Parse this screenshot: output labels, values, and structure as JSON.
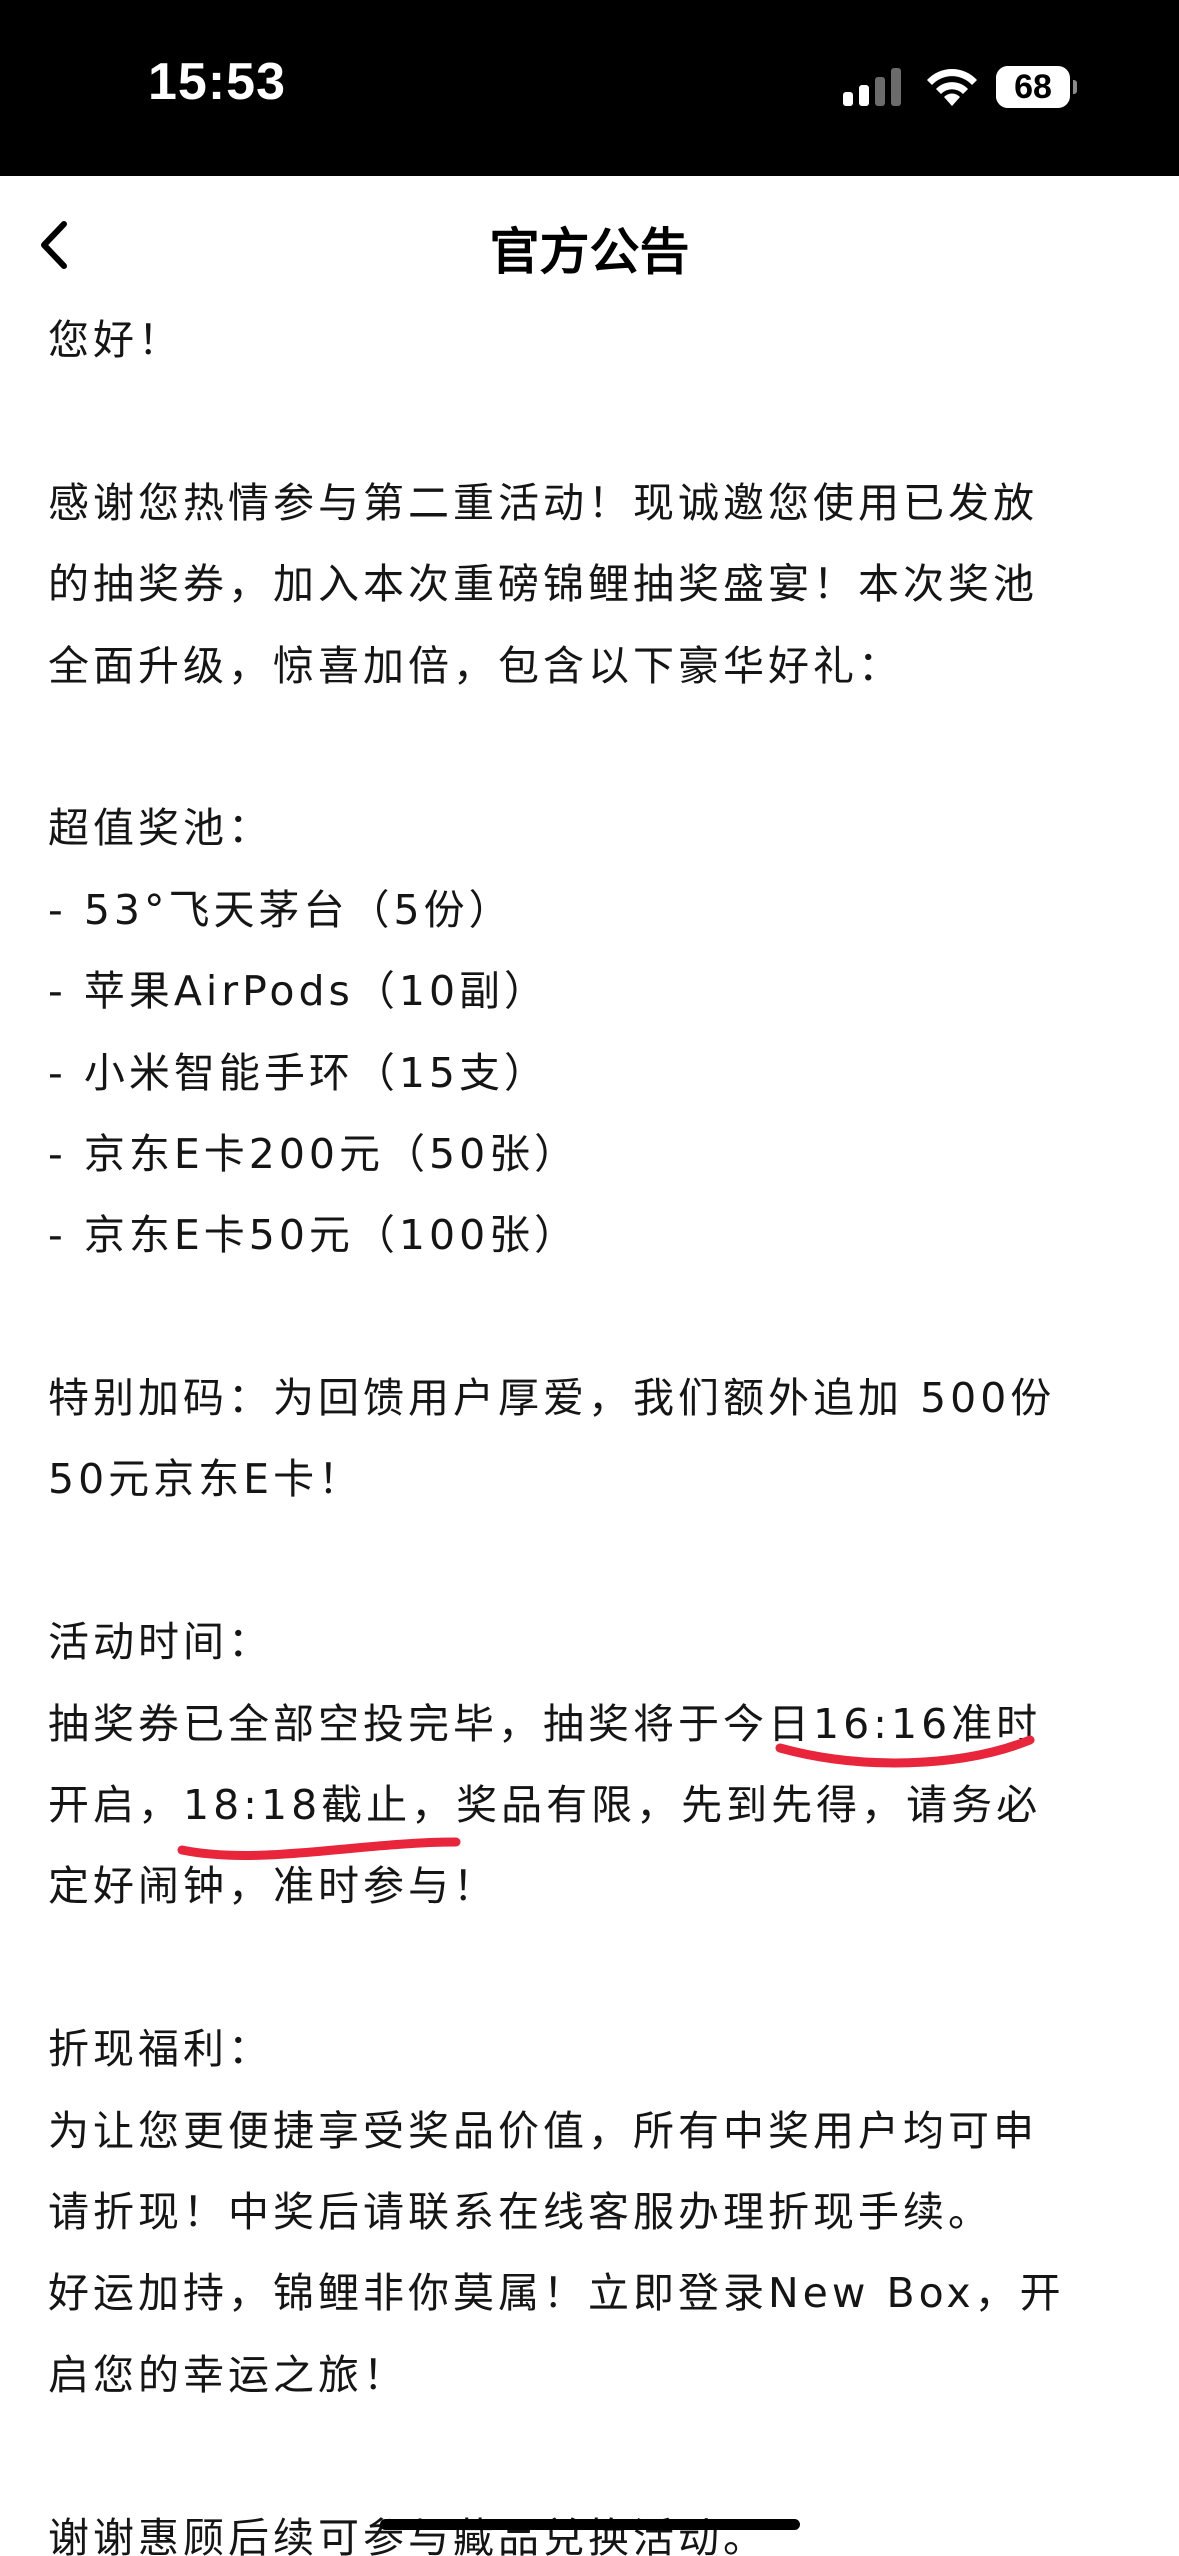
{
  "status_bar": {
    "time": "15:53",
    "battery": "68",
    "battery_level": 0.68,
    "icons": [
      "cellular-signal-icon",
      "wifi-icon",
      "battery-icon"
    ]
  },
  "nav": {
    "back_icon": "chevron-left-icon",
    "title": "官方公告"
  },
  "article": {
    "greeting": "您好！",
    "intro": [
      "感谢您热情参与第二重活动！现诚邀您使用已发放",
      "的抽奖券，加入本次重磅锦鲤抽奖盛宴！本次奖池",
      "全面升级，惊喜加倍，包含以下豪华好礼："
    ],
    "prize_heading": "超值奖池：",
    "prizes": [
      "- 53°飞天茅台（5份）",
      "- 苹果AirPods（10副）",
      "- 小米智能手环（15支）",
      "- 京东E卡200元（50张）",
      "- 京东E卡50元（100张）"
    ],
    "bonus": [
      "特别加码：为回馈用户厚爱，我们额外追加 500份",
      "50元京东E卡！"
    ],
    "time_heading": "活动时间：",
    "time_lines": [
      "抽奖券已全部空投完毕，抽奖将于今日16:16准时",
      "开启，18:18截止，奖品有限，先到先得，请务必",
      "定好闹钟，准时参与！"
    ],
    "cash_heading": "折现福利：",
    "cash_lines": [
      "为让您更便捷享受奖品价值，所有中奖用户均可申",
      "请折现！中奖后请联系在线客服办理折现手续。",
      "好运加持，锦鲤非你莫属！立即登录New Box，开",
      "启您的幸运之旅！"
    ],
    "closing": "谢谢惠顾后续可参与藏品兑换活动。"
  },
  "colors": {
    "status_bar_bg": "#000000",
    "page_bg": "#ffffff",
    "text": "#151515",
    "annotation": "#e8253a"
  }
}
